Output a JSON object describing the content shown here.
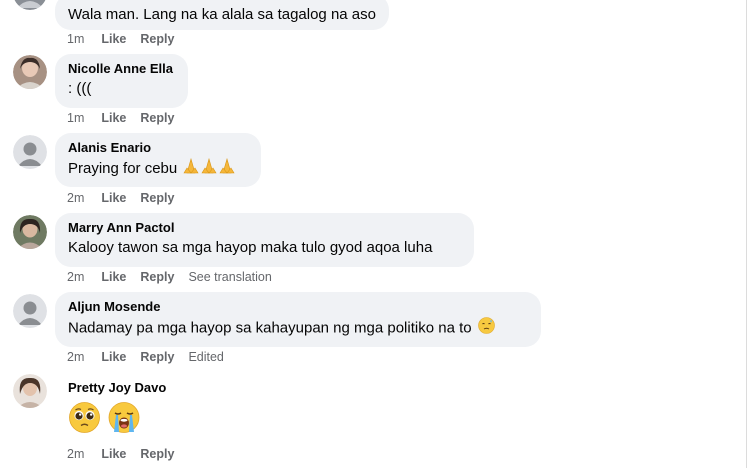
{
  "comments": [
    {
      "author": "",
      "text": "Wala man. Lang na ka alala sa tagalog na aso",
      "time": "1m",
      "like": "Like",
      "reply": "Reply",
      "extra": ""
    },
    {
      "author": "Nicolle Anne Ella",
      "text": ": (((",
      "time": "1m",
      "like": "Like",
      "reply": "Reply",
      "extra": ""
    },
    {
      "author": "Alanis Enario",
      "text": "Praying for cebu",
      "emoji": "folded-hands x3",
      "time": "2m",
      "like": "Like",
      "reply": "Reply",
      "extra": ""
    },
    {
      "author": "Marry Ann Pactol",
      "text": "Kalooy tawon sa mga hayop maka tulo gyod aqoa luha",
      "time": "2m",
      "like": "Like",
      "reply": "Reply",
      "extra": "See translation"
    },
    {
      "author": "Aljun Mosende",
      "text": "Nadamay pa mga hayop sa kahayupan ng mga politiko na to",
      "emoji": "downcast-sweat-face",
      "time": "2m",
      "like": "Like",
      "reply": "Reply",
      "extra": "Edited"
    },
    {
      "author": "Pretty Joy Davo",
      "text": "",
      "emoji": "pleading-face, loudly-crying-face",
      "time": "2m",
      "like": "Like",
      "reply": "Reply",
      "extra": ""
    }
  ],
  "colors": {
    "bubble": "#f0f2f5",
    "meta": "#65676b",
    "text": "#050505"
  }
}
